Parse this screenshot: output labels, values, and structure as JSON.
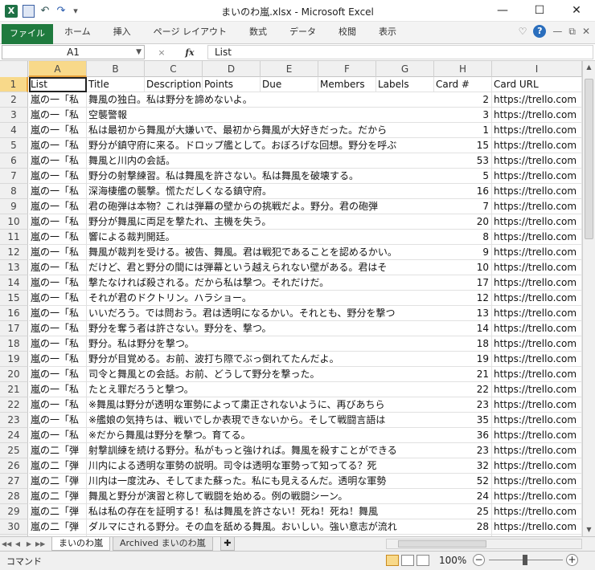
{
  "window": {
    "title": "まいのわ嵐.xlsx - Microsoft Excel",
    "minimize": "—",
    "maximize": "☐",
    "close": "✕"
  },
  "quick_access": {
    "app_icon": "X",
    "undo": "↶",
    "redo": "↷",
    "customize": "▾"
  },
  "ribbon": {
    "tabs": [
      "ファイル",
      "ホーム",
      "挿入",
      "ページ レイアウト",
      "数式",
      "データ",
      "校閲",
      "表示"
    ],
    "help": "?",
    "collapse": "♡",
    "min": "—",
    "restore": "⧉",
    "close": "✕"
  },
  "formula_bar": {
    "name_box": "A1",
    "dropdown": "▼",
    "cancel": "×",
    "fx": "fx",
    "value": "List"
  },
  "columns": [
    "A",
    "B",
    "C",
    "D",
    "E",
    "F",
    "G",
    "H",
    "I"
  ],
  "header_row": {
    "A": "List",
    "B": "Title",
    "C": "Description",
    "D": "Points",
    "E": "Due",
    "F": "Members",
    "G": "Labels",
    "H": "Card #",
    "I": "Card URL"
  },
  "rows": [
    {
      "n": "2",
      "a": "嵐の一「私",
      "b": "舞風の独白。私は野分を諦めないよ。",
      "h": "2",
      "i": "https://trello.com"
    },
    {
      "n": "3",
      "a": "嵐の一「私",
      "b": "空襲警報",
      "h": "3",
      "i": "https://trello.com"
    },
    {
      "n": "4",
      "a": "嵐の一「私",
      "b": "私は最初から舞風が大嫌いで、最初から舞風が大好きだった。だから",
      "h": "1",
      "i": "https://trello.com"
    },
    {
      "n": "5",
      "a": "嵐の一「私",
      "b": "野分が鎮守府に来る。ドロップ艦として。おぼろげな回想。野分を呼ぶ",
      "h": "15",
      "i": "https://trello.com"
    },
    {
      "n": "6",
      "a": "嵐の一「私",
      "b": "舞風と川内の会話。",
      "h": "53",
      "i": "https://trello.com"
    },
    {
      "n": "7",
      "a": "嵐の一「私",
      "b": "野分の射撃練習。私は舞風を許さない。私は舞風を破壊する。",
      "h": "5",
      "i": "https://trello.com"
    },
    {
      "n": "8",
      "a": "嵐の一「私",
      "b": "深海棲艦の襲撃。慌ただしくなる鎮守府。",
      "h": "16",
      "i": "https://trello.com"
    },
    {
      "n": "9",
      "a": "嵐の一「私",
      "b": "君の砲弾は本物？これは弾幕の壁からの挑戦だよ。野分。君の砲弾",
      "h": "7",
      "i": "https://trello.com"
    },
    {
      "n": "10",
      "a": "嵐の一「私",
      "b": "野分が舞風に両足を撃たれ、主機を失う。",
      "h": "20",
      "i": "https://trello.com"
    },
    {
      "n": "11",
      "a": "嵐の一「私",
      "b": "響による裁判開廷。",
      "h": "8",
      "i": "https://trello.com"
    },
    {
      "n": "12",
      "a": "嵐の一「私",
      "b": "舞風が裁判を受ける。被告、舞風。君は戦犯であることを認めるかい。",
      "h": "9",
      "i": "https://trello.com"
    },
    {
      "n": "13",
      "a": "嵐の一「私",
      "b": "だけど、君と野分の間には弾幕という越えられない壁がある。君はそ",
      "h": "10",
      "i": "https://trello.com"
    },
    {
      "n": "14",
      "a": "嵐の一「私",
      "b": "撃たなければ殺される。だから私は撃つ。それだけだ。",
      "h": "17",
      "i": "https://trello.com"
    },
    {
      "n": "15",
      "a": "嵐の一「私",
      "b": "それが君のドクトリン。ハラショー。",
      "h": "12",
      "i": "https://trello.com"
    },
    {
      "n": "16",
      "a": "嵐の一「私",
      "b": "いいだろう。では問おう。君は透明になるかい。それとも、野分を撃つ",
      "h": "13",
      "i": "https://trello.com"
    },
    {
      "n": "17",
      "a": "嵐の一「私",
      "b": "野分を奪う者は許さない。野分を、撃つ。",
      "h": "14",
      "i": "https://trello.com"
    },
    {
      "n": "18",
      "a": "嵐の一「私",
      "b": "野分。私は野分を撃つ。",
      "h": "18",
      "i": "https://trello.com"
    },
    {
      "n": "19",
      "a": "嵐の一「私",
      "b": "野分が目覚める。お前、波打ち際でぶっ倒れてたんだよ。",
      "h": "19",
      "i": "https://trello.com"
    },
    {
      "n": "20",
      "a": "嵐の一「私",
      "b": "司令と舞風との会話。お前、どうして野分を撃った。",
      "h": "21",
      "i": "https://trello.com"
    },
    {
      "n": "21",
      "a": "嵐の一「私",
      "b": "たとえ罪だろうと撃つ。",
      "h": "22",
      "i": "https://trello.com"
    },
    {
      "n": "22",
      "a": "嵐の一「私",
      "b": "※舞風は野分が透明な軍勢によって粛正されないように、再びあちら",
      "h": "23",
      "i": "https://trello.com"
    },
    {
      "n": "23",
      "a": "嵐の一「私",
      "b": "※艦娘の気持ちは、戦いでしか表現できないから。そして戦闘言語は",
      "h": "35",
      "i": "https://trello.com"
    },
    {
      "n": "24",
      "a": "嵐の一「私",
      "b": "※だから舞風は野分を撃つ。育てる。",
      "h": "36",
      "i": "https://trello.com"
    },
    {
      "n": "25",
      "a": "嵐の二「弾",
      "b": "射撃訓練を続ける野分。私がもっと強ければ。舞風を殺すことができる",
      "h": "23",
      "i": "https://trello.com"
    },
    {
      "n": "26",
      "a": "嵐の二「弾",
      "b": "川内による透明な軍勢の説明。司令は透明な軍勢って知ってる？死",
      "h": "32",
      "i": "https://trello.com"
    },
    {
      "n": "27",
      "a": "嵐の二「弾",
      "b": "川内は一度沈み、そしてまた蘇った。私にも見えるんだ。透明な軍勢",
      "h": "52",
      "i": "https://trello.com"
    },
    {
      "n": "28",
      "a": "嵐の二「弾",
      "b": "舞風と野分が演習と称して戦闘を始める。例の戦闘シーン。",
      "h": "24",
      "i": "https://trello.com"
    },
    {
      "n": "29",
      "a": "嵐の二「弾",
      "b": "私は私の存在を証明する！私は舞風を許さない！死ね！死ね！舞風",
      "h": "25",
      "i": "https://trello.com"
    },
    {
      "n": "30",
      "a": "嵐の二「弾",
      "b": "ダルマにされる野分。その血を舐める舞風。おいしい。強い意志が流れ",
      "h": "28",
      "i": "https://trello.com"
    },
    {
      "n": "31",
      "a": "嵐の二「弾",
      "b": "再び響による裁判。",
      "h": "6",
      "i": "https://trello.com"
    },
    {
      "n": "32",
      "a": "嵐の二「弾",
      "b": "舞風と響との対話。",
      "h": "27",
      "i": "https://trello.com"
    }
  ],
  "sheet_tabs": {
    "nav": [
      "◀◀",
      "◀",
      "▶",
      "▶▶"
    ],
    "tab1": "まいのわ嵐",
    "tab2": "Archived まいのわ嵐",
    "new": "✚"
  },
  "status": {
    "mode": "コマンド",
    "zoom": "100%",
    "zoom_minus": "−",
    "zoom_plus": "+"
  },
  "colors": {
    "file_tab": "#1f7a3e",
    "selected_header": "#f8d98a"
  }
}
